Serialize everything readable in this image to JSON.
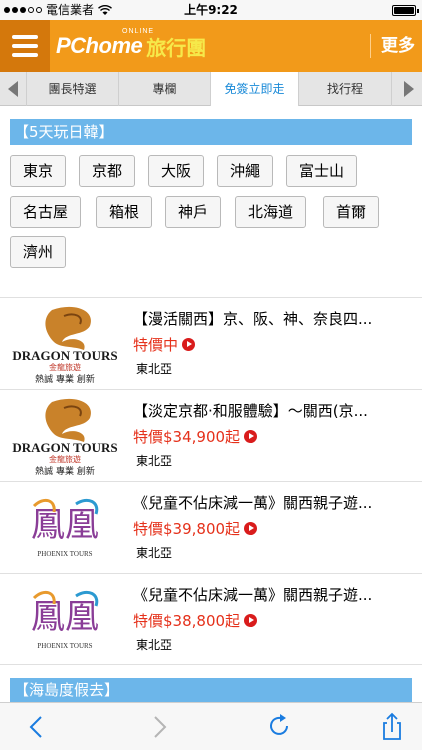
{
  "status_bar": {
    "carrier": "電信業者",
    "time": "上午9:22"
  },
  "header": {
    "logo_brand": "PChome",
    "logo_online": "ONLINE",
    "logo_travel": "旅行團",
    "more_label": "更多",
    "colors": {
      "background": "#f29a1a",
      "menu_bg": "#d4780c"
    }
  },
  "tabs": [
    {
      "label": "團長特選",
      "active": false
    },
    {
      "label": "專欄",
      "active": false
    },
    {
      "label": "免簽立即走",
      "active": true
    },
    {
      "label": "找行程",
      "active": false
    }
  ],
  "section1": {
    "title": "【5天玩日韓】",
    "regions": [
      "東京",
      "京都",
      "大阪",
      "沖繩",
      "富士山",
      "名古屋",
      "箱根",
      "神戶",
      "北海道",
      "首爾",
      "濟州"
    ]
  },
  "listings": [
    {
      "logo": "dragon-tours",
      "logo_text": "DRAGON TOURS",
      "logo_cn": "金龍旅遊",
      "logo_tagline": "熱誠 專業 創新",
      "title": "【漫活關西】京、阪、神、奈良四...",
      "price": "特價中",
      "region": "東北亞"
    },
    {
      "logo": "dragon-tours",
      "logo_text": "DRAGON TOURS",
      "logo_cn": "金龍旅遊",
      "logo_tagline": "熱誠 專業 創新",
      "title": "【淡定京都‧和服體驗】～關西(京...",
      "price": "特價$34,900起",
      "region": "東北亞"
    },
    {
      "logo": "phoenix-tours",
      "logo_text": "PHOENIX TOURS",
      "logo_cn": "鳳凰",
      "title": "《兒童不佔床減一萬》關西親子遊...",
      "price": "特價$39,800起",
      "region": "東北亞"
    },
    {
      "logo": "phoenix-tours",
      "logo_text": "PHOENIX TOURS",
      "logo_cn": "鳳凰",
      "title": "《兒童不佔床減一萬》關西親子遊...",
      "price": "特價$38,800起",
      "region": "東北亞"
    }
  ],
  "section2": {
    "title": "【海島度假去】"
  },
  "toolbar": {
    "back": "back-icon",
    "forward": "forward-icon",
    "reload": "reload-icon",
    "share": "share-icon"
  },
  "accent_colors": {
    "section_bar": "#6cb6ea",
    "price": "#e5311b",
    "active_tab_text": "#1a8ad8"
  }
}
